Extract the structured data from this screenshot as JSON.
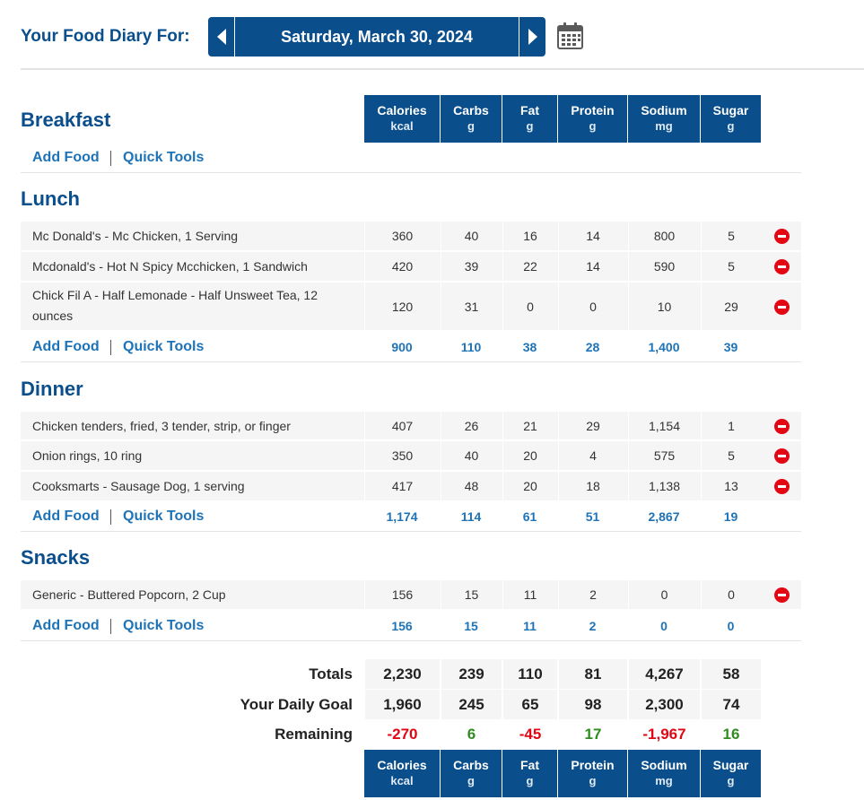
{
  "header": {
    "title": "Your Food Diary For:",
    "date": "Saturday, March 30, 2024",
    "prev_icon": "chevron-left-icon",
    "next_icon": "chevron-right-icon",
    "calendar_icon": "calendar-icon"
  },
  "columns": [
    {
      "label": "Calories",
      "unit": "kcal"
    },
    {
      "label": "Carbs",
      "unit": "g"
    },
    {
      "label": "Fat",
      "unit": "g"
    },
    {
      "label": "Protein",
      "unit": "g"
    },
    {
      "label": "Sodium",
      "unit": "mg"
    },
    {
      "label": "Sugar",
      "unit": "g"
    }
  ],
  "links": {
    "add_food": "Add Food",
    "quick_tools": "Quick Tools"
  },
  "meals": {
    "breakfast": {
      "title": "Breakfast",
      "items": [],
      "totals": []
    },
    "lunch": {
      "title": "Lunch",
      "items": [
        {
          "name": "Mc Donald's - Mc Chicken, 1 Serving",
          "values": [
            "360",
            "40",
            "16",
            "14",
            "800",
            "5"
          ]
        },
        {
          "name": "Mcdonald's - Hot N Spicy Mcchicken, 1 Sandwich",
          "values": [
            "420",
            "39",
            "22",
            "14",
            "590",
            "5"
          ]
        },
        {
          "name": "Chick Fil A - Half Lemonade - Half Unsweet Tea, 12 ounces",
          "values": [
            "120",
            "31",
            "0",
            "0",
            "10",
            "29"
          ]
        }
      ],
      "totals": [
        "900",
        "110",
        "38",
        "28",
        "1,400",
        "39"
      ]
    },
    "dinner": {
      "title": "Dinner",
      "items": [
        {
          "name": "Chicken tenders, fried, 3 tender, strip, or finger",
          "values": [
            "407",
            "26",
            "21",
            "29",
            "1,154",
            "1"
          ]
        },
        {
          "name": "Onion rings, 10 ring",
          "values": [
            "350",
            "40",
            "20",
            "4",
            "575",
            "5"
          ]
        },
        {
          "name": "Cooksmarts - Sausage Dog, 1 serving",
          "values": [
            "417",
            "48",
            "20",
            "18",
            "1,138",
            "13"
          ]
        }
      ],
      "totals": [
        "1,174",
        "114",
        "61",
        "51",
        "2,867",
        "19"
      ]
    },
    "snacks": {
      "title": "Snacks",
      "items": [
        {
          "name": "Generic - Buttered Popcorn, 2 Cup",
          "values": [
            "156",
            "15",
            "11",
            "2",
            "0",
            "0"
          ]
        }
      ],
      "totals": [
        "156",
        "15",
        "11",
        "2",
        "0",
        "0"
      ]
    }
  },
  "summary": {
    "totals": {
      "label": "Totals",
      "values": [
        "2,230",
        "239",
        "110",
        "81",
        "4,267",
        "58"
      ]
    },
    "goal": {
      "label": "Your Daily Goal",
      "values": [
        "1,960",
        "245",
        "65",
        "98",
        "2,300",
        "74"
      ]
    },
    "remaining": {
      "label": "Remaining",
      "values": [
        "-270",
        "6",
        "-45",
        "17",
        "-1,967",
        "16"
      ]
    }
  },
  "colors": {
    "brand": "#0a4f8c",
    "link": "#1e73b6",
    "negative": "#e30613",
    "positive": "#2e8b1e"
  }
}
